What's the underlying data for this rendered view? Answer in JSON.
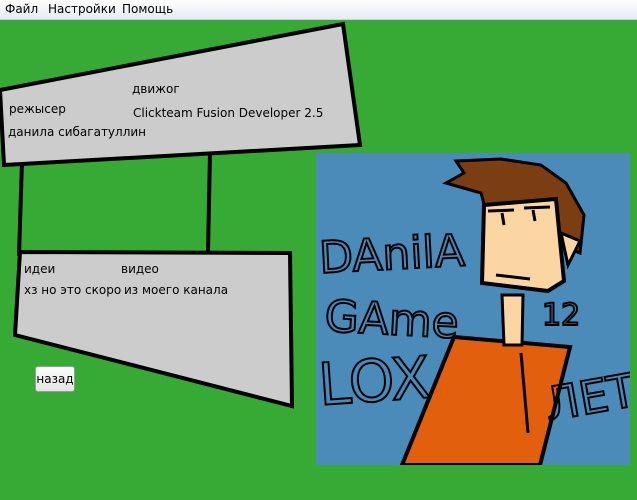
{
  "menu": {
    "file": "Файл",
    "settings": "Настройки",
    "help": "Помощь"
  },
  "colors": {
    "background": "#37a935",
    "panel": "#cccccc",
    "avatar_bg": "#4a8bb9",
    "shirt": "#e2600d",
    "skin": "#fbd6a3",
    "hair": "#7a3e12"
  },
  "credits_panel": {
    "director_label": "режысер",
    "director_value": "данила сибагатуллин",
    "engine_label": "движог",
    "engine_value": "Clickteam Fusion Developer 2.5"
  },
  "info_panel": {
    "ideas_label": "идеи",
    "ideas_value": "хз но это скоро",
    "video_label": "видео",
    "video_value": "из моего канала"
  },
  "back_button": "назад",
  "avatar_text": {
    "line1": "DAnilA",
    "line2": "GAme",
    "line3": "LOX",
    "age": "12",
    "years": "ЛЕТ"
  }
}
